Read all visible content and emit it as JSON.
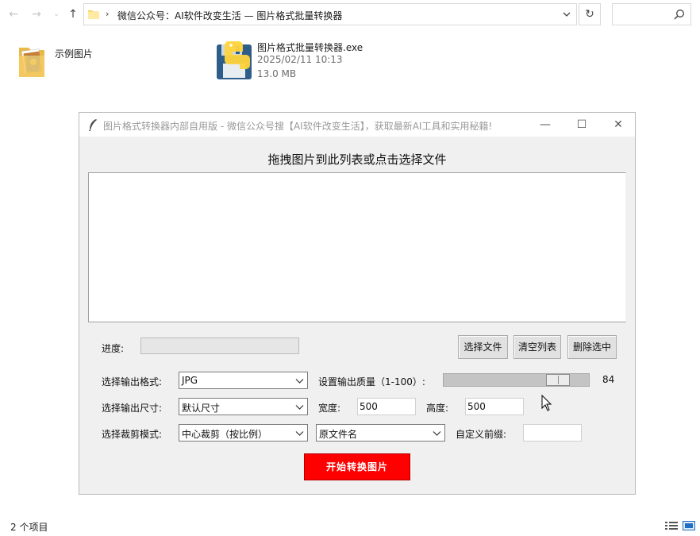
{
  "explorer": {
    "path_text": "微信公众号：AI软件改变生活 — 图片格式批量转换器",
    "status": "2 个项目"
  },
  "files": [
    {
      "name": "示例图片"
    },
    {
      "name": "图片格式批量转换器.exe",
      "date": "2025/02/11 10:13",
      "size": "13.0 MB"
    }
  ],
  "app": {
    "title": "图片格式转换器内部自用版 - 微信公众号搜【AI软件改变生活】，获取最新AI工具和实用秘籍!",
    "drop_prompt": "拖拽图片到此列表或点击选择文件",
    "progress_label": "进度:",
    "progress_value": 0,
    "buttons": {
      "select": "选择文件",
      "clear": "清空列表",
      "delete": "删除选中",
      "start": "开始转换图片"
    },
    "format_label": "选择输出格式:",
    "format_value": "JPG",
    "quality_label": "设置输出质量（1-100）:",
    "quality_value": "84",
    "quality_fraction": 0.84,
    "size_label": "选择输出尺寸:",
    "size_value": "默认尺寸",
    "width_label": "宽度:",
    "width_value": "500",
    "height_label": "高度:",
    "height_value": "500",
    "crop_label": "选择裁剪模式:",
    "crop_value": "中心裁剪（按比例）",
    "naming_value": "原文件名",
    "prefix_label": "自定义前缀:",
    "prefix_value": ""
  },
  "colors": {
    "start_button": "#fe0000",
    "progress_fill": "#06b025"
  }
}
